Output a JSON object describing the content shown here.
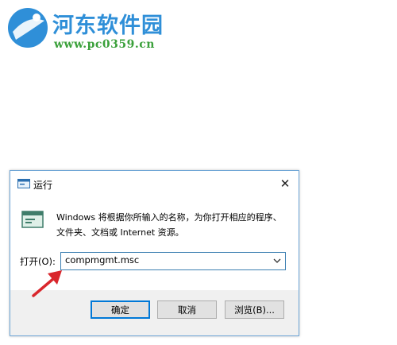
{
  "watermark": {
    "site_name": "河东软件园",
    "site_url": "www.pc0359.cn"
  },
  "dialog": {
    "title": "运行",
    "description": "Windows 将根据你所输入的名称，为你打开相应的程序、文件夹、文档或 Internet 资源。",
    "open_label": "打开(O):",
    "command_value": "compmgmt.msc",
    "buttons": {
      "ok": "确定",
      "cancel": "取消",
      "browse": "浏览(B)..."
    }
  },
  "icons": {
    "title": "run-icon",
    "body": "run-app-icon",
    "close": "close-icon",
    "dropdown": "chevron-down-icon",
    "annotation": "red-arrow-icon"
  },
  "colors": {
    "watermark_blue": "#2f8fd8",
    "watermark_green": "#3aa03a",
    "accent": "#0078d7",
    "arrow_red": "#d9262c"
  }
}
